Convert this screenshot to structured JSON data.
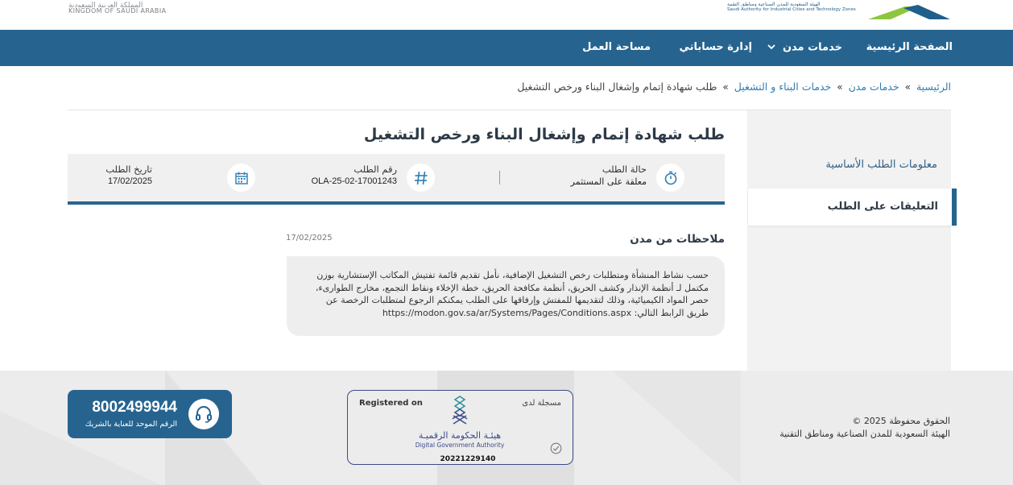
{
  "header": {
    "ksa_ar": "المملكة العربية السعودية",
    "ksa_en": "KINGDOM OF SAUDI ARABIA",
    "modon_ar": "الهيئة السعودية للمدن الصناعية ومناطق التقنية",
    "modon_en": "Saudi Authority for Industrial Cities and Technology Zones"
  },
  "nav": {
    "home": "الصفحة الرئيسية",
    "services": "خدمات مدن",
    "accounts": "إدارة حساباتي",
    "workspace": "مساحة العمل"
  },
  "breadcrumb": {
    "home": "الرئيسية",
    "services": "خدمات مدن",
    "building": "خدمات البناء و التشغيل",
    "current": "طلب شهادة إتمام وإشغال البناء ورخص التشغيل"
  },
  "sidebar": {
    "items": [
      {
        "label": "معلومات الطلب الأساسية"
      },
      {
        "label": "التعليقات على الطلب"
      }
    ]
  },
  "main": {
    "title": "طلب شهادة إتمام وإشغال البناء ورخص التشغيل",
    "status_label": "حالة الطلب",
    "status_value": "معلقة على المستثمر",
    "number_label": "رقم الطلب",
    "number_value": "OLA-25-02-17001243",
    "date_label": "تاريخ الطلب",
    "date_value": "17/02/2025"
  },
  "notes": {
    "title": "ملاحظات من مدن",
    "date": "17/02/2025",
    "lines": [
      "حسب نشاط المنشأة ومتطلبات رخص التشغيل الإضافية، نأمل تقديم قائمة تفتيش المكاتب الإستشارية بوزن",
      "مكتمل لـ أنظمة الإنذار وكشف الحريق، أنظمة مكافحة الحريق، خطة الإخلاء ونقاط التجمع، مخارج الطوارىء،",
      "حصر المواد الكيميائية، وذلك لتقديمها للمفتش وإرفاقها على الطلب يمكنكم الرجوع لمتطلبات الرخصة عن",
      "طريق الرابط التالي: https://modon.gov.sa/ar/Systems/Pages/Conditions.aspx"
    ]
  },
  "footer": {
    "hotline_number": "8002499944",
    "hotline_label": "الرقم الموحد للعناية بالشريك",
    "registered_en": "Registered on",
    "registered_ar": "مسجلة لدى",
    "dga_ar": "هيئـة الحكومة الرقميـة",
    "dga_en": "Digital Government Authority",
    "reg_number": "20221229140",
    "copyright": "الحقوق محفوظة 2025 ©",
    "org": "الهيئة السعودية للمدن الصناعية ومناطق التقنية"
  },
  "colors": {
    "primary": "#26648f",
    "link": "#2f7cb3",
    "dga": "#3d4a8a"
  }
}
